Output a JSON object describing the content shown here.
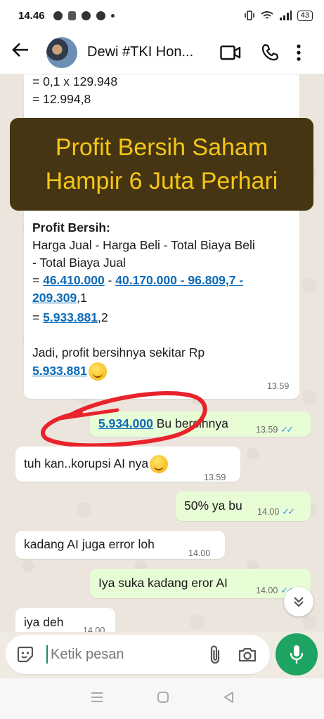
{
  "status_bar": {
    "time": "14.46",
    "battery": "43"
  },
  "header": {
    "contact_name": "Dewi #TKI Hon..."
  },
  "banner": {
    "line1": "Profit Bersih Saham",
    "line2": "Hampir 6 Juta Perhari"
  },
  "big_message": {
    "line1": "= 0,1 x 129.948",
    "line2": "= 12.994,8",
    "heading": "Profit Bersih:",
    "formula1": "Harga Jual - Harga Beli - Total Biaya Beli",
    "formula2": "- Total Biaya Jual",
    "calc_eq": "= ",
    "calc_a": "46.410.000",
    "calc_sep1": " - ",
    "calc_b": "40.170.000 - 96.809,7 -",
    "calc_c": "209.309",
    "calc_c_suffix": ",1",
    "result_eq": "= ",
    "result": "5.933.881",
    "result_suffix": ",2",
    "summary": "Jadi, profit bersihnya sekitar Rp",
    "summary_value": "5.933.881",
    "time": "13.59"
  },
  "messages": [
    {
      "dir": "out",
      "link": "5.934.000",
      "text": " Bu bersihnya",
      "time": "13.59"
    },
    {
      "dir": "in",
      "text": "tuh kan..korupsi AI nya",
      "time": "13.59"
    },
    {
      "dir": "out",
      "text": "50% ya bu",
      "time": "14.00"
    },
    {
      "dir": "in",
      "text": "kadang AI juga error loh",
      "time": "14.00"
    },
    {
      "dir": "out",
      "text": "Iya suka kadang eror AI",
      "time": "14.00"
    },
    {
      "dir": "in",
      "text": "iya deh",
      "time": "14.00"
    }
  ],
  "composer": {
    "placeholder": "Ketik pesan"
  },
  "colors": {
    "accent": "#1da462",
    "banner_bg": "#453512",
    "banner_text": "#f5c518",
    "annotation": "#e8232b",
    "link": "#0b6ab8"
  }
}
